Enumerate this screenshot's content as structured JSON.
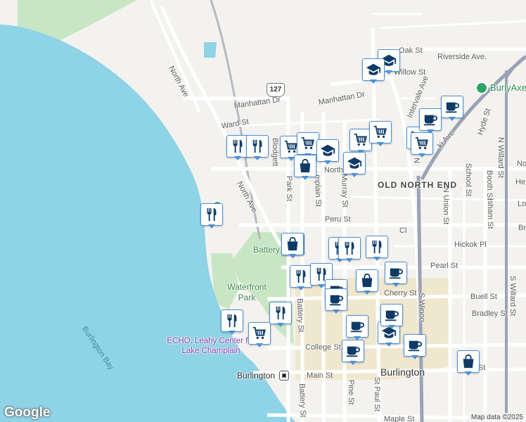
{
  "map": {
    "colors": {
      "water": "#8ed3e6",
      "park": "#c8e6c4",
      "land": "#f3f2ef",
      "downtown": "#f0e7cf",
      "road": "#ffffff",
      "rail": "#9aa3b5"
    },
    "labels": {
      "north_ave_top": "North Ave",
      "north_ave_mid": "North Ave",
      "manhattan_dr_w": "Manhattan Dr",
      "manhattan_dr_e": "Manhattan Dr",
      "ward_st": "Ward St",
      "oak_st": "Oak St",
      "willow_st": "Willow St",
      "riverside_ave": "Riverside Ave.",
      "intervale_ave": "Intervale Ave",
      "ki_ave": "ki Ave",
      "hyde_st": "Hyde St",
      "n_willard_st_top": "N Willard St",
      "n_willard_st": "N Willard St",
      "school_st": "School St",
      "booth_st": "Booth St",
      "isham_st": "Isham St",
      "n_union_st": "N Union St",
      "hickok_pl": "Hickok Pl",
      "peru_st": "Peru St",
      "pearl_st": "Pearl St",
      "cherry_st": "Cherry St",
      "buell_st": "Buell St",
      "bradley_st": "Bradley St",
      "college_st": "College St",
      "main_st": "Main St",
      "main_st_e": "Main St",
      "maple_st": "Maple St",
      "pine_st": "Pine St",
      "st_paul_st": "St Paul St",
      "battery_st": "Battery St",
      "battery_st_s": "Battery St",
      "park_st": "Park St",
      "champlain_st": "mplain St",
      "murray_st": "Murray St",
      "s_winooski": "S Winoo",
      "n_winooski": "N",
      "north_st": "North",
      "old_north_end": "OLD NORTH END",
      "burlington": "Burlington",
      "burlington_station": "Burlington",
      "burlington_bay": "Burlington Bay",
      "waterfront_park": "Waterfront Park",
      "battery": "Battery",
      "echo": "ECHO, Leahy Center for Lake Champlain",
      "burly": "BurlyAxe",
      "route_127": "127",
      "edge_he": "He",
      "edge_lo": "Lo",
      "edge_br": "Br",
      "edge_no": "No",
      "edge_s_willard": "S Willard St",
      "edge_cl": "Cl",
      "blodgett": "Blodgett",
      "bl": "Bl"
    },
    "pins": [
      {
        "icon": "restaurant-icon"
      },
      {
        "icon": "restaurant-icon"
      },
      {
        "icon": "restaurant-icon"
      },
      {
        "icon": "restaurant-icon"
      },
      {
        "icon": "restaurant-icon"
      },
      {
        "icon": "restaurant-icon"
      },
      {
        "icon": "restaurant-icon"
      },
      {
        "icon": "restaurant-icon"
      },
      {
        "icon": "restaurant-icon"
      },
      {
        "icon": "restaurant-icon"
      },
      {
        "icon": "restaurant-icon"
      },
      {
        "icon": "grocery-cart-icon"
      },
      {
        "icon": "grocery-cart-icon"
      },
      {
        "icon": "grocery-cart-icon"
      },
      {
        "icon": "grocery-cart-icon"
      },
      {
        "icon": "grocery-cart-icon"
      },
      {
        "icon": "grocery-cart-icon"
      },
      {
        "icon": "grocery-cart-icon"
      },
      {
        "icon": "school-icon"
      },
      {
        "icon": "school-icon"
      },
      {
        "icon": "school-icon"
      },
      {
        "icon": "school-icon"
      },
      {
        "icon": "school-icon"
      },
      {
        "icon": "shopping-bag-icon"
      },
      {
        "icon": "shopping-bag-icon"
      },
      {
        "icon": "shopping-bag-icon"
      },
      {
        "icon": "shopping-bag-icon"
      },
      {
        "icon": "cafe-icon"
      },
      {
        "icon": "cafe-icon"
      },
      {
        "icon": "cafe-icon"
      },
      {
        "icon": "cafe-icon"
      },
      {
        "icon": "cafe-icon"
      },
      {
        "icon": "cafe-icon"
      },
      {
        "icon": "cafe-icon"
      },
      {
        "icon": "cafe-icon"
      },
      {
        "icon": "cafe-icon"
      }
    ],
    "logo": "Google",
    "attribution": "Map data ©2025"
  }
}
